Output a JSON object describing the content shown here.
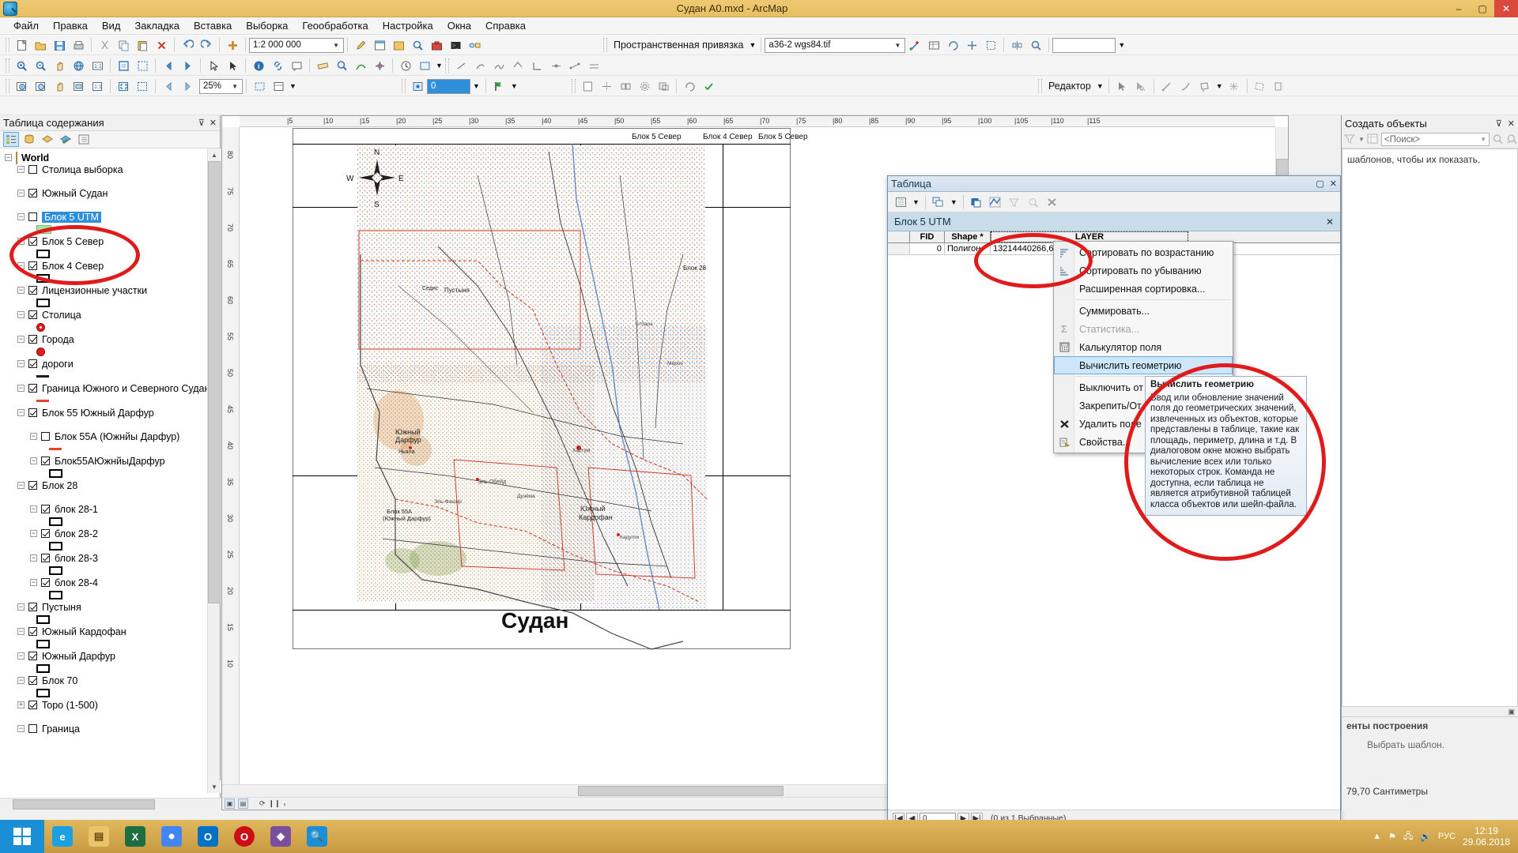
{
  "window": {
    "title": "Судан A0.mxd - ArcMap",
    "minimize": "–",
    "maximize": "▢",
    "close": "✕"
  },
  "menu": {
    "items": [
      "Файл",
      "Правка",
      "Вид",
      "Закладка",
      "Вставка",
      "Выборка",
      "Геообработка",
      "Настройка",
      "Окна",
      "Справка"
    ]
  },
  "toolbars": {
    "scale_value": "1:2 000 000",
    "zoom_percent": "25%",
    "georef_label": "Пространственная привязка",
    "georef_layer": "a36-2 wgs84.tif",
    "editor_label": "Редактор",
    "edit_target_value": "0",
    "blank_box": ""
  },
  "toc": {
    "title": "Таблица содержания",
    "pin": "⊽",
    "close": "✕",
    "nodes": [
      {
        "indent": 0,
        "expander": "−",
        "checkbox": "none",
        "label": "World",
        "style": "bold",
        "symbol": "stack"
      },
      {
        "indent": 1,
        "expander": "−",
        "checkbox": "off",
        "label": "Столица выборка",
        "symbol": "none"
      },
      {
        "indent": 1,
        "expander": "−",
        "checkbox": "on",
        "label": "Южный Судан",
        "symbol": "none"
      },
      {
        "indent": 1,
        "expander": "−",
        "checkbox": "off",
        "label": "Блок 5 UTM",
        "style": "selected",
        "symbol": "green"
      },
      {
        "indent": 1,
        "expander": "−",
        "checkbox": "on",
        "label": "Блок 5 Север",
        "symbol": "poly"
      },
      {
        "indent": 1,
        "expander": "−",
        "checkbox": "on",
        "label": "Блок 4 Север",
        "symbol": "poly"
      },
      {
        "indent": 1,
        "expander": "−",
        "checkbox": "on",
        "label": "Лицензионные участки",
        "symbol": "poly"
      },
      {
        "indent": 1,
        "expander": "−",
        "checkbox": "on",
        "label": "Столица",
        "symbol": "dot-ring"
      },
      {
        "indent": 1,
        "expander": "−",
        "checkbox": "on",
        "label": "Города",
        "symbol": "dot"
      },
      {
        "indent": 1,
        "expander": "−",
        "checkbox": "on",
        "label": "дороги",
        "symbol": "line"
      },
      {
        "indent": 1,
        "expander": "−",
        "checkbox": "on",
        "label": "Граница Южного и Северного Судана",
        "symbol": "line-red"
      },
      {
        "indent": 1,
        "expander": "−",
        "checkbox": "on",
        "label": "Блок 55 Южный Дарфур",
        "symbol": "none"
      },
      {
        "indent": 2,
        "expander": "−",
        "checkbox": "off",
        "label": "Блок 55А (Южнйы Дарфур)",
        "symbol": "line-red"
      },
      {
        "indent": 2,
        "expander": "−",
        "checkbox": "on",
        "label": "Блок55АЮжнйыДарфур",
        "symbol": "poly"
      },
      {
        "indent": 1,
        "expander": "−",
        "checkbox": "on",
        "label": "Блок 28",
        "symbol": "none"
      },
      {
        "indent": 2,
        "expander": "−",
        "checkbox": "on",
        "label": "блок 28-1",
        "symbol": "poly"
      },
      {
        "indent": 2,
        "expander": "−",
        "checkbox": "on",
        "label": "блок 28-2",
        "symbol": "poly"
      },
      {
        "indent": 2,
        "expander": "−",
        "checkbox": "on",
        "label": "блок 28-3",
        "symbol": "poly"
      },
      {
        "indent": 2,
        "expander": "−",
        "checkbox": "on",
        "label": "блок 28-4",
        "symbol": "poly"
      },
      {
        "indent": 1,
        "expander": "−",
        "checkbox": "on",
        "label": "Пустыня",
        "symbol": "poly"
      },
      {
        "indent": 1,
        "expander": "−",
        "checkbox": "on",
        "label": "Южный Кардофан",
        "symbol": "poly"
      },
      {
        "indent": 1,
        "expander": "−",
        "checkbox": "on",
        "label": "Южный Дарфур",
        "symbol": "poly"
      },
      {
        "indent": 1,
        "expander": "−",
        "checkbox": "on",
        "label": "Блок 70",
        "symbol": "poly"
      },
      {
        "indent": 1,
        "expander": "+",
        "checkbox": "on",
        "label": "Topo (1-500)",
        "symbol": "none"
      },
      {
        "indent": 1,
        "expander": "−",
        "checkbox": "off",
        "label": "Граница",
        "symbol": "none"
      }
    ]
  },
  "map": {
    "title": "Судан",
    "compass_n": "N",
    "compass_s": "S",
    "compass_e": "E",
    "compass_w": "W",
    "block_labels": [
      "Блок 5 Север",
      "Блок 4 Север",
      "Блок 5 Север",
      "Блок 28",
      "Южный Дарфур",
      "Блок 55А (Южный Дарфур)",
      "Южный Кардофан",
      "Пустыня"
    ],
    "ruler_top_ticks": [
      "5",
      "10",
      "15",
      "20",
      "25",
      "30",
      "35",
      "40",
      "45",
      "50",
      "55",
      "60",
      "65",
      "70",
      "75",
      "80",
      "85",
      "90",
      "95",
      "100",
      "105",
      "110",
      "115"
    ],
    "ruler_left_ticks": [
      "80",
      "75",
      "70",
      "65",
      "60",
      "55",
      "50",
      "45",
      "40",
      "35",
      "30",
      "25",
      "20",
      "15",
      "10"
    ]
  },
  "table_window": {
    "title": "Таблица",
    "restore": "▢",
    "close": "✕",
    "tab_label": "Блок 5 UTM",
    "tab_close": "✕",
    "columns": [
      "",
      "FID",
      "Shape *",
      "LAYER"
    ],
    "rows": [
      {
        "sel": "",
        "fid": "0",
        "shape": "Полигон",
        "layer": "13214440266,67"
      }
    ],
    "nav": {
      "first": "|◀",
      "prev": "◀",
      "record": "0",
      "next": "▶",
      "last": "▶|",
      "status": "(0 из 1 Выбранные)"
    }
  },
  "context_menu": {
    "items": [
      {
        "label": "Сортировать по возрастанию",
        "icon": "sort-asc-icon",
        "state": "normal"
      },
      {
        "label": "Сортировать по убыванию",
        "icon": "sort-desc-icon",
        "state": "normal"
      },
      {
        "label": "Расширенная сортировка...",
        "icon": "none",
        "state": "normal"
      },
      {
        "sep": true
      },
      {
        "label": "Суммировать...",
        "icon": "none",
        "state": "normal"
      },
      {
        "label": "Статистика...",
        "icon": "sigma-icon",
        "state": "disabled"
      },
      {
        "label": "Калькулятор поля",
        "icon": "calculator-icon",
        "state": "normal"
      },
      {
        "label": "Вычислить геометрию",
        "icon": "none",
        "state": "highlighted"
      },
      {
        "sep": true
      },
      {
        "label": "Выключить от",
        "icon": "none",
        "state": "normal"
      },
      {
        "label": "Закрепить/От",
        "icon": "none",
        "state": "normal"
      },
      {
        "label": "Удалить поле",
        "icon": "delete-icon",
        "state": "normal"
      },
      {
        "label": "Свойства...",
        "icon": "properties-icon",
        "state": "normal"
      }
    ]
  },
  "tooltip": {
    "title": "Вычислить геометрию",
    "body": "Ввод или обновление значений поля до геометрических значений, извлеченных из объектов, которые представлены в таблице, такие как площадь, периметр, длина и т.д. В диалоговом окне можно выбрать вычисление всех или только некоторых строк. Команда не доступна, если таблица не является атрибутивной таблицей класса объектов или шейп-файла."
  },
  "right_panel": {
    "title": "Создать объекты",
    "pin": "⊽",
    "close": "✕",
    "search_placeholder": "<Поиск>",
    "body_text": "шаблонов, чтобы их показать.",
    "construct_title": "енты построения",
    "construct_hint": "Выбрать шаблон.",
    "coords": "79,70 Сантиметры"
  },
  "taskbar": {
    "start": "start-button",
    "apps": [
      {
        "name": "internet-explorer-icon",
        "letter": "e",
        "color": "#1ba1e2"
      },
      {
        "name": "file-explorer-icon",
        "letter": "▤",
        "color": "#e9c46a"
      },
      {
        "name": "excel-icon",
        "letter": "X",
        "color": "#1d6f42"
      },
      {
        "name": "chrome-icon",
        "letter": "◉",
        "color": "#4285f4"
      },
      {
        "name": "outlook-icon",
        "letter": "O",
        "color": "#0072c6"
      },
      {
        "name": "opera-icon",
        "letter": "O",
        "color": "#cc0f16"
      },
      {
        "name": "arcmap-icon",
        "letter": "◆",
        "color": "#7a4fa0"
      },
      {
        "name": "arccatalog-icon",
        "letter": "🔍",
        "color": "#1a8fd6"
      }
    ],
    "tray": {
      "expand": "▲",
      "flag": "⚑",
      "network": "🖧",
      "volume": "🔊",
      "language": "РУС"
    },
    "time": "12:19",
    "date": "29.06.2018"
  },
  "colors": {
    "title_bar": "#e8bf63",
    "accent_selection": "#2f8fd8",
    "annotation_red": "#e01b1b",
    "highlight_blue": "#cde6f9"
  }
}
